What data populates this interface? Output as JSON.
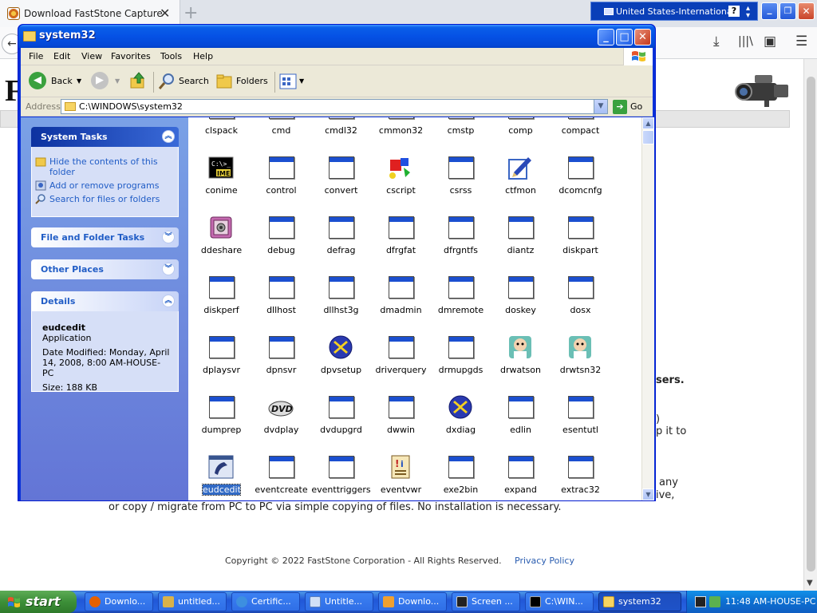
{
  "browser": {
    "tab_title": "Download FastStone Capture",
    "tab_close": "✕",
    "new_tab": "+",
    "language_bar": "United States-International",
    "language_help": "?"
  },
  "webpage": {
    "logo_fragment": "F",
    "fragments": {
      "users": "sers.",
      "it_to": "p it to",
      "any": "any",
      "ive": "ive,",
      "paren": ")"
    },
    "migrate_line": "or copy / migrate from PC to PC via simple copying of files. No installation is necessary.",
    "copyright": "Copyright © 2022 FastStone Corporation - All Rights Reserved.",
    "privacy": "Privacy Policy"
  },
  "explorer": {
    "title": "system32",
    "menu": [
      "File",
      "Edit",
      "View",
      "Favorites",
      "Tools",
      "Help"
    ],
    "toolbar": {
      "back": "Back",
      "search": "Search",
      "folders": "Folders"
    },
    "address": {
      "label": "Address",
      "value": "C:\\WINDOWS\\system32",
      "go": "Go"
    },
    "task_pane": {
      "system_tasks": {
        "title": "System Tasks",
        "links": [
          "Hide the contents of this folder",
          "Add or remove programs",
          "Search for files or folders"
        ]
      },
      "file_folder_tasks": "File and Folder Tasks",
      "other_places": "Other Places",
      "details": {
        "title": "Details",
        "name": "eudcedit",
        "type": "Application",
        "modified": "Date Modified: Monday, April 14, 2008, 8:00 AM-HOUSE-PC",
        "size": "Size: 188 KB"
      }
    },
    "files": [
      {
        "name": "clspack",
        "icon": "exe"
      },
      {
        "name": "cmd",
        "icon": "exe"
      },
      {
        "name": "cmdl32",
        "icon": "exe"
      },
      {
        "name": "cmmon32",
        "icon": "exe"
      },
      {
        "name": "cmstp",
        "icon": "exe"
      },
      {
        "name": "comp",
        "icon": "exe"
      },
      {
        "name": "compact",
        "icon": "exe"
      },
      {
        "name": "conime",
        "icon": "ime"
      },
      {
        "name": "control",
        "icon": "exe"
      },
      {
        "name": "convert",
        "icon": "exe"
      },
      {
        "name": "cscript",
        "icon": "script"
      },
      {
        "name": "csrss",
        "icon": "exe"
      },
      {
        "name": "ctfmon",
        "icon": "pen"
      },
      {
        "name": "dcomcnfg",
        "icon": "exe"
      },
      {
        "name": "ddeshare",
        "icon": "safe"
      },
      {
        "name": "debug",
        "icon": "exe"
      },
      {
        "name": "defrag",
        "icon": "exe"
      },
      {
        "name": "dfrgfat",
        "icon": "exe"
      },
      {
        "name": "dfrgntfs",
        "icon": "exe"
      },
      {
        "name": "diantz",
        "icon": "exe"
      },
      {
        "name": "diskpart",
        "icon": "exe"
      },
      {
        "name": "diskperf",
        "icon": "exe"
      },
      {
        "name": "dllhost",
        "icon": "exe"
      },
      {
        "name": "dllhst3g",
        "icon": "exe"
      },
      {
        "name": "dmadmin",
        "icon": "exe"
      },
      {
        "name": "dmremote",
        "icon": "exe"
      },
      {
        "name": "doskey",
        "icon": "exe"
      },
      {
        "name": "dosx",
        "icon": "exe"
      },
      {
        "name": "dplaysvr",
        "icon": "exe"
      },
      {
        "name": "dpnsvr",
        "icon": "exe"
      },
      {
        "name": "dpvsetup",
        "icon": "dx"
      },
      {
        "name": "driverquery",
        "icon": "exe"
      },
      {
        "name": "drmupgds",
        "icon": "exe"
      },
      {
        "name": "drwatson",
        "icon": "doctor"
      },
      {
        "name": "drwtsn32",
        "icon": "doctor"
      },
      {
        "name": "dumprep",
        "icon": "exe"
      },
      {
        "name": "dvdplay",
        "icon": "dvd"
      },
      {
        "name": "dvdupgrd",
        "icon": "exe"
      },
      {
        "name": "dwwin",
        "icon": "exe"
      },
      {
        "name": "dxdiag",
        "icon": "dx"
      },
      {
        "name": "edlin",
        "icon": "exe"
      },
      {
        "name": "esentutl",
        "icon": "exe"
      },
      {
        "name": "eudcedit",
        "icon": "eudc",
        "selected": true
      },
      {
        "name": "eventcreate",
        "icon": "exe"
      },
      {
        "name": "eventtriggers",
        "icon": "exe"
      },
      {
        "name": "eventvwr",
        "icon": "event"
      },
      {
        "name": "exe2bin",
        "icon": "exe"
      },
      {
        "name": "expand",
        "icon": "exe"
      },
      {
        "name": "extrac32",
        "icon": "exe"
      }
    ]
  },
  "taskbar": {
    "start": "start",
    "buttons": [
      "Downlo...",
      "untitled...",
      "Certific...",
      "Untitle...",
      "Downlo...",
      "Screen ...",
      "C:\\WIN...",
      "system32"
    ],
    "clock": "11:48 AM-HOUSE-PC"
  },
  "colors": {
    "xp_blue": "#0a5fe9",
    "task_pane": "#7aa1e6",
    "selection": "#316ac5",
    "start_green": "#3c8f38"
  }
}
